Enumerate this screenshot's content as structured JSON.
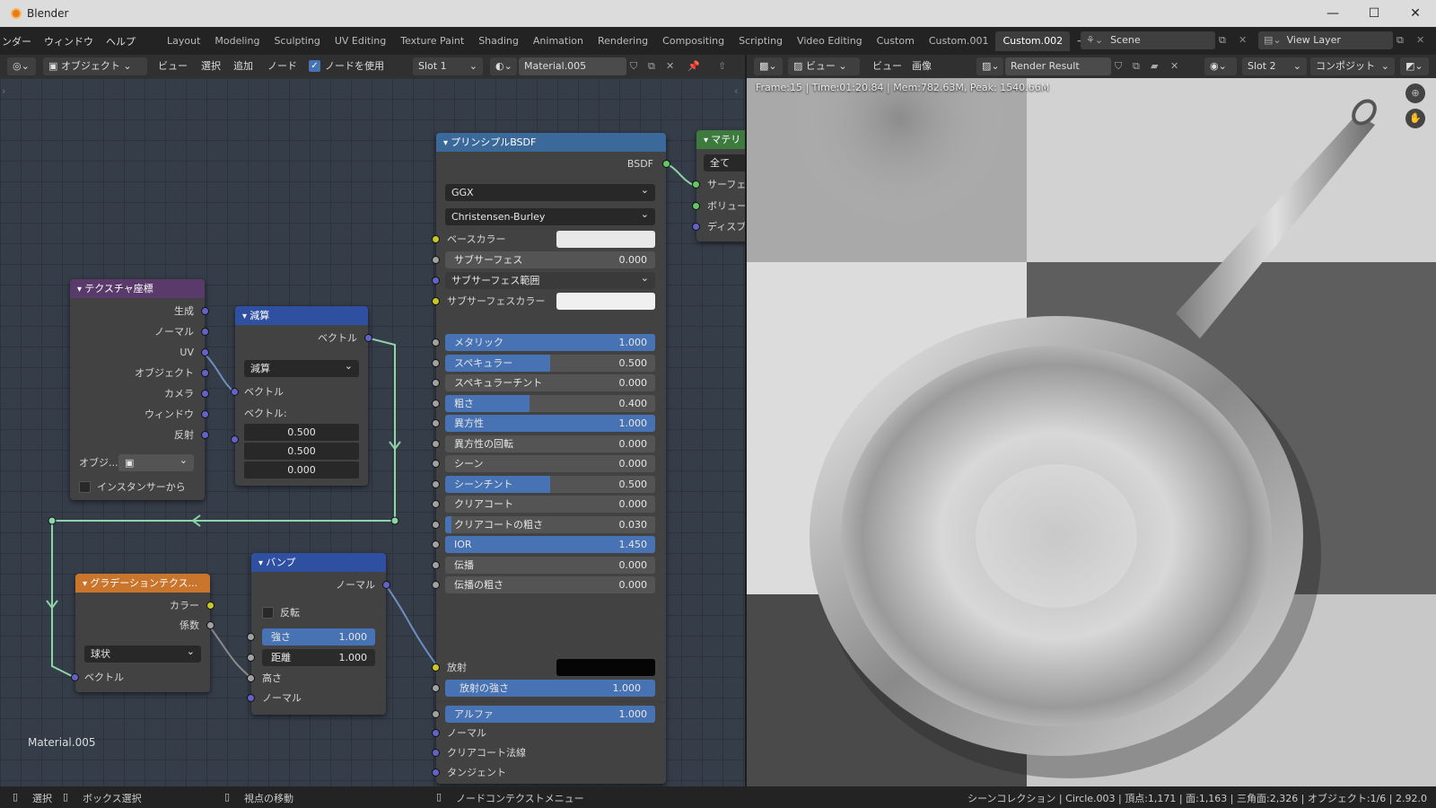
{
  "window": {
    "title": "Blender",
    "controls": [
      "—",
      "☐",
      "✕"
    ]
  },
  "menus": [
    "ンダー",
    "ウィンドウ",
    "ヘルプ"
  ],
  "workspaces": [
    "Layout",
    "Modeling",
    "Sculpting",
    "UV Editing",
    "Texture Paint",
    "Shading",
    "Animation",
    "Rendering",
    "Compositing",
    "Scripting",
    "Video Editing",
    "Custom",
    "Custom.001",
    "Custom.002"
  ],
  "active_workspace": "Custom.002",
  "scene": {
    "name": "Scene",
    "view_layer": "View Layer"
  },
  "node_header": {
    "mode": "オブジェクト",
    "view": "ビュー",
    "select": "選択",
    "add": "追加",
    "node": "ノード",
    "use_nodes": "ノードを使用",
    "slot": "Slot 1",
    "material": "Material.005"
  },
  "image_header": {
    "view": "ビュー",
    "view2": "ビュー",
    "image": "画像",
    "image_name": "Render Result",
    "slot": "Slot 2",
    "pass": "コンポジット"
  },
  "render_info": "Frame:15 | Time:01:20.84 | Mem:782.63M, Peak: 1540.66M",
  "material_label": "Material.005",
  "nodes": {
    "tex_coord": {
      "title": "テクスチャ座標",
      "outputs": [
        "生成",
        "ノーマル",
        "UV",
        "オブジェクト",
        "カメラ",
        "ウィンドウ",
        "反射"
      ],
      "object_label": "オブジ...",
      "instancer": "インスタンサーから"
    },
    "subtract": {
      "title": "減算",
      "output": "ベクトル",
      "operation": "減算",
      "input1": "ベクトル",
      "input2_label": "ベクトル:",
      "values": [
        "0.500",
        "0.500",
        "0.000"
      ]
    },
    "gradient": {
      "title": "グラデーションテクス...",
      "outputs": [
        "カラー",
        "係数"
      ],
      "type": "球状",
      "input": "ベクトル"
    },
    "bump": {
      "title": "バンプ",
      "output": "ノーマル",
      "invert": "反転",
      "strength": {
        "label": "強さ",
        "value": "1.000",
        "fill": 1.0
      },
      "distance": {
        "label": "距離",
        "value": "1.000",
        "fill": 0.0
      },
      "inputs": [
        "高さ",
        "ノーマル"
      ]
    },
    "bsdf": {
      "title": "プリンシプルBSDF",
      "output": "BSDF",
      "distribution": "GGX",
      "subsurface_method": "Christensen-Burley",
      "base_color": {
        "label": "ベースカラー",
        "color": "#e8e8e8"
      },
      "subsurface": {
        "label": "サブサーフェス",
        "value": "0.000",
        "fill": 0.0
      },
      "subsurface_radius": "サブサーフェス範囲",
      "subsurface_color": {
        "label": "サブサーフェスカラー",
        "color": "#f0f0f0"
      },
      "sliders": [
        {
          "label": "メタリック",
          "value": "1.000",
          "fill": 1.0
        },
        {
          "label": "スペキュラー",
          "value": "0.500",
          "fill": 0.5
        },
        {
          "label": "スペキュラーチント",
          "value": "0.000",
          "fill": 0.0
        },
        {
          "label": "粗さ",
          "value": "0.400",
          "fill": 0.4
        },
        {
          "label": "異方性",
          "value": "1.000",
          "fill": 1.0
        },
        {
          "label": "異方性の回転",
          "value": "0.000",
          "fill": 0.0
        },
        {
          "label": "シーン",
          "value": "0.000",
          "fill": 0.0
        },
        {
          "label": "シーンチント",
          "value": "0.500",
          "fill": 0.5
        },
        {
          "label": "クリアコート",
          "value": "0.000",
          "fill": 0.0
        },
        {
          "label": "クリアコートの粗さ",
          "value": "0.030",
          "fill": 0.03
        },
        {
          "label": "IOR",
          "value": "1.450",
          "fill": 1.0
        },
        {
          "label": "伝播",
          "value": "0.000",
          "fill": 0.0
        },
        {
          "label": "伝播の粗さ",
          "value": "0.000",
          "fill": 0.0
        }
      ],
      "emission": {
        "label": "放射",
        "color": "#050505"
      },
      "emission_strength": {
        "label": "放射の強さ",
        "value": "1.000",
        "fill": 1.0
      },
      "alpha": {
        "label": "アルファ",
        "value": "1.000",
        "fill": 1.0
      },
      "vector_inputs": [
        "ノーマル",
        "クリアコート法線",
        "タンジェント"
      ]
    },
    "output": {
      "title": "マテリ",
      "target": "全て",
      "inputs": [
        "サーフェ",
        "ボリュー",
        "ディスプ"
      ]
    }
  },
  "status": {
    "select": "選択",
    "box_select": "ボックス選択",
    "pan": "視点の移動",
    "context": "ノードコンテクストメニュー",
    "stats": "シーンコレクション | Circle.003 | 頂点:1,171 | 面:1,163 | 三角面:2,326 | オブジェクト:1/6 | 2.92.0"
  },
  "colors": {
    "accent": "#4772b3",
    "shader_header": "#3b6a9a",
    "vector_header": "#2f4fa0",
    "texture_header": "#c9752b",
    "output_header": "#3d7a3d"
  }
}
